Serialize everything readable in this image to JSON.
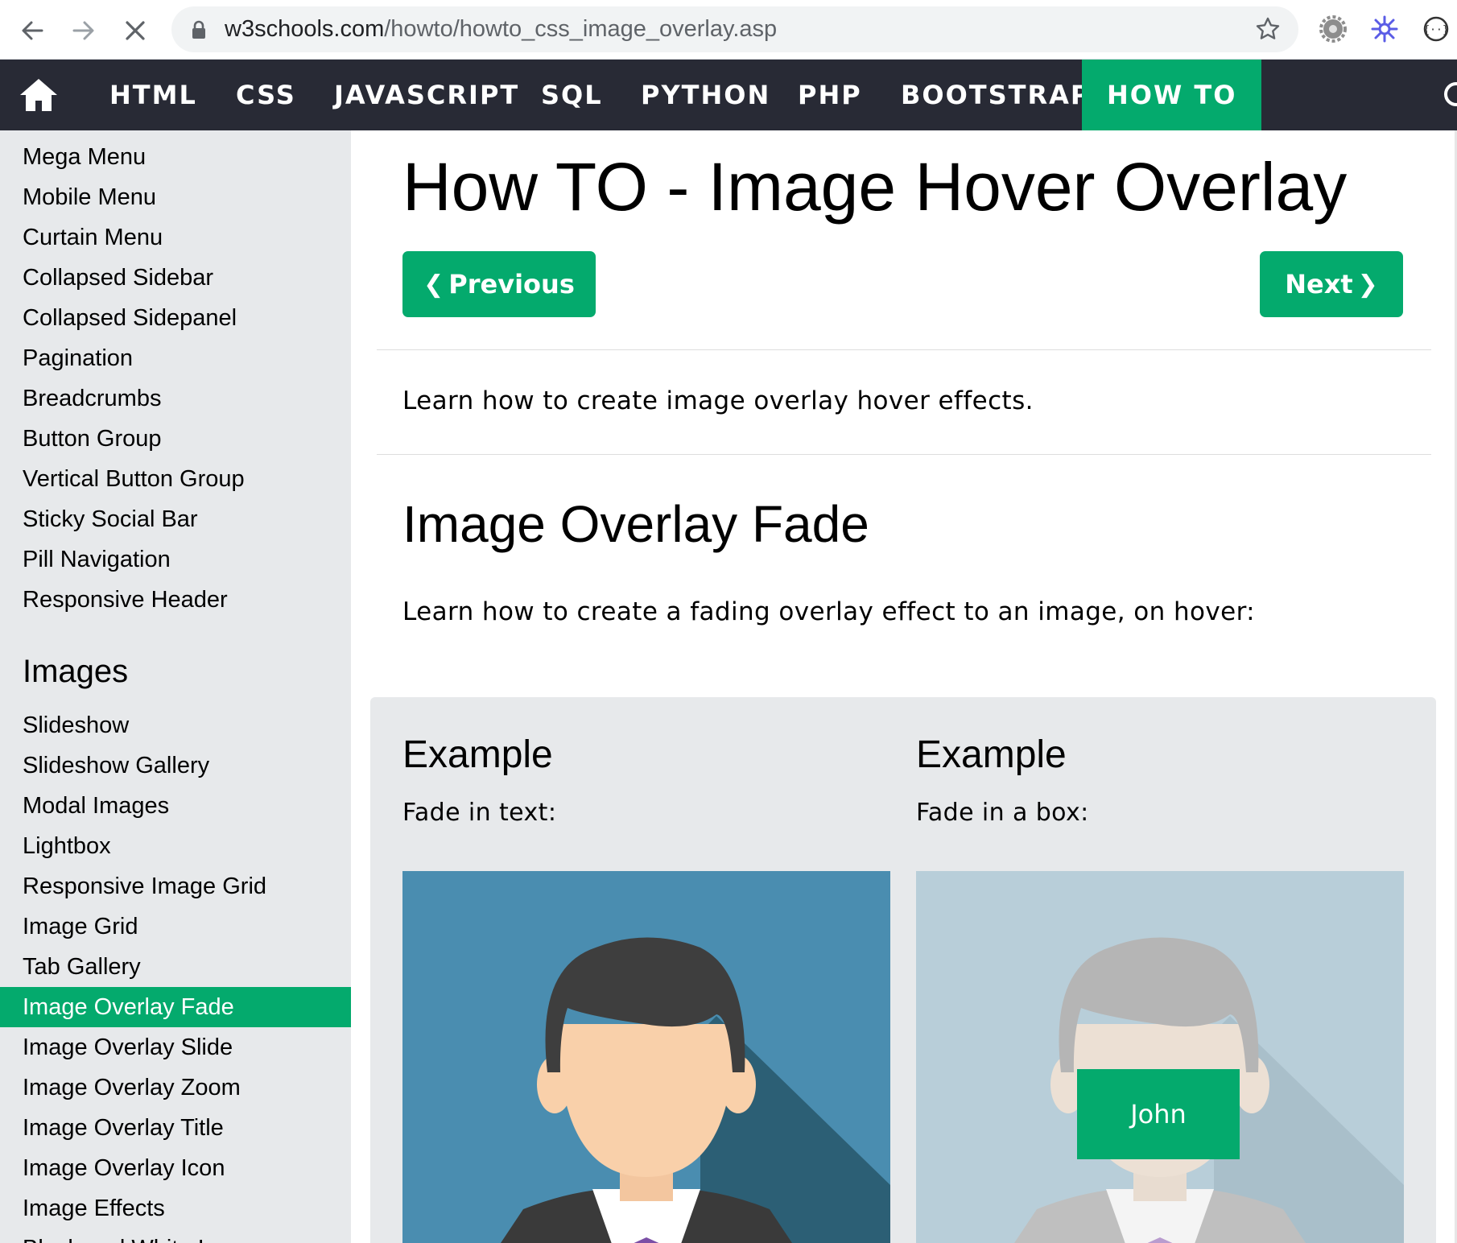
{
  "browser": {
    "url_domain": "w3schools.com",
    "url_path": "/howto/howto_css_image_overlay.asp",
    "back_icon": "arrow-left-icon",
    "forward_icon": "arrow-right-icon",
    "stop_icon": "close-icon",
    "lock_icon": "lock-icon",
    "bookmark_icon": "star-icon"
  },
  "topnav": {
    "home_icon": "home-icon",
    "items": [
      "HTML",
      "CSS",
      "JAVASCRIPT",
      "SQL",
      "PYTHON",
      "PHP",
      "BOOTSTRAP",
      "HOW TO"
    ],
    "active": "HOW TO"
  },
  "sidebar": {
    "menu_items": [
      "Mega Menu",
      "Mobile Menu",
      "Curtain Menu",
      "Collapsed Sidebar",
      "Collapsed Sidepanel",
      "Pagination",
      "Breadcrumbs",
      "Button Group",
      "Vertical Button Group",
      "Sticky Social Bar",
      "Pill Navigation",
      "Responsive Header"
    ],
    "images_heading": "Images",
    "image_items": [
      "Slideshow",
      "Slideshow Gallery",
      "Modal Images",
      "Lightbox",
      "Responsive Image Grid",
      "Image Grid",
      "Tab Gallery",
      "Image Overlay Fade",
      "Image Overlay Slide",
      "Image Overlay Zoom",
      "Image Overlay Title",
      "Image Overlay Icon",
      "Image Effects",
      "Black and White Image"
    ],
    "active": "Image Overlay Fade"
  },
  "main": {
    "title": "How TO - Image Hover Overlay",
    "previous_label": "Previous",
    "next_label": "Next",
    "intro": "Learn how to create image overlay hover effects.",
    "section_title": "Image Overlay Fade",
    "section_lead": "Learn how to create a fading overlay effect to an image, on hover:",
    "examples": [
      {
        "title": "Example",
        "subtitle": "Fade in text:"
      },
      {
        "title": "Example",
        "subtitle": "Fade in a box:",
        "overlay_text": "John"
      }
    ]
  },
  "colors": {
    "nav_bg": "#282a35",
    "accent": "#04aa6d",
    "sidebar_bg": "#e7e9eb"
  }
}
